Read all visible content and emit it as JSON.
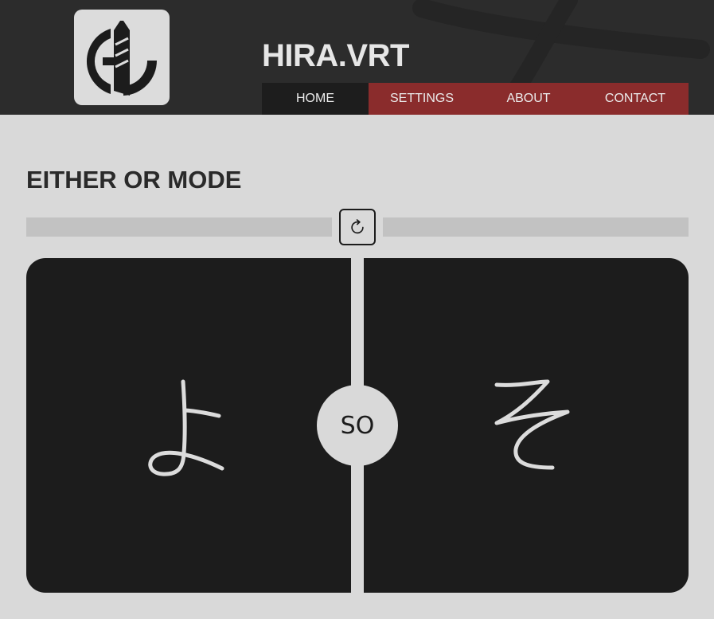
{
  "header": {
    "site_title": "HIRA.VRT",
    "logo_icon": "hira-vrt-logo"
  },
  "nav": {
    "items": [
      {
        "label": "HOME",
        "active": true
      },
      {
        "label": "SETTINGS",
        "active": false
      },
      {
        "label": "ABOUT",
        "active": false
      },
      {
        "label": "CONTACT",
        "active": false
      }
    ]
  },
  "main": {
    "mode_title": "EITHER OR MODE",
    "refresh_icon": "refresh-icon",
    "choices": [
      {
        "kana": "よ"
      },
      {
        "kana": "そ"
      }
    ],
    "romaji": "SO"
  },
  "colors": {
    "header_bg": "#2c2c2c",
    "nav_active": "#1d1d1d",
    "nav_accent": "#8a2c2c",
    "page_bg": "#d9d9d9",
    "card_bg": "#1c1c1c",
    "kana_color": "#dcdcdc"
  }
}
